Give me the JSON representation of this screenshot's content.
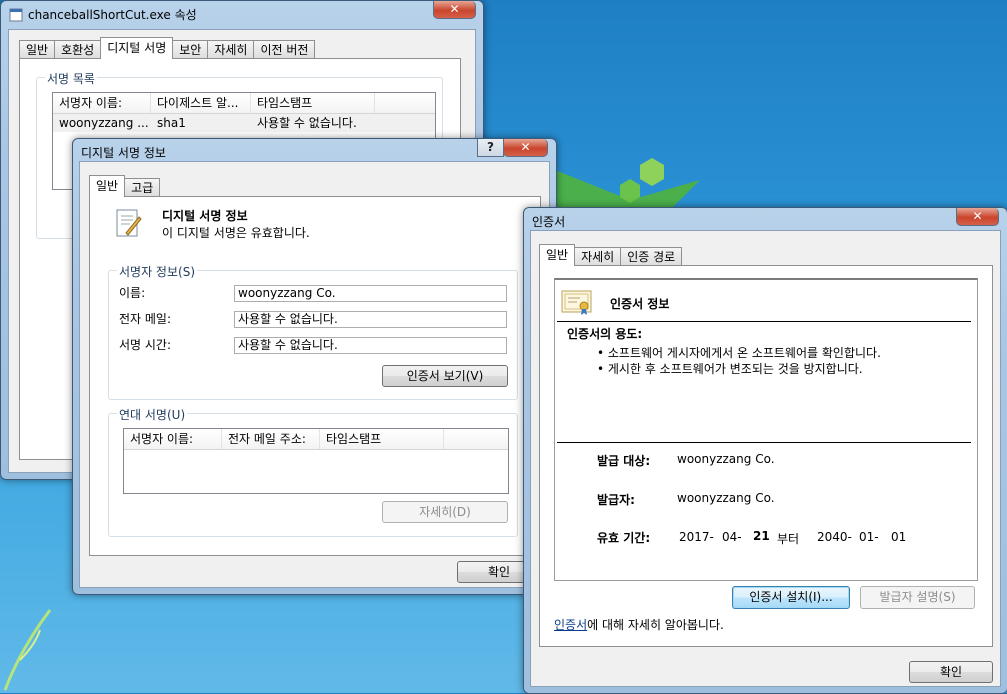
{
  "properties_window": {
    "title": "chanceballShortCut.exe 속성",
    "tabs": [
      "일반",
      "호환성",
      "디지털 서명",
      "보안",
      "자세히",
      "이전 버전"
    ],
    "signature_list_label": "서명 목록",
    "columns": [
      "서명자 이름:",
      "다이제스트 알...",
      "타임스탬프"
    ],
    "rows": [
      [
        "woonyzzang ...",
        "sha1",
        "사용할 수 없습니다."
      ]
    ]
  },
  "sig_info_window": {
    "title": "디지털 서명 정보",
    "help_button": "?",
    "tabs": [
      "일반",
      "고급"
    ],
    "heading": "디지털 서명 정보",
    "status": "이 디지털 서명은 유효합니다.",
    "signer_group": "서명자 정보(S)",
    "fields": [
      {
        "label": "이름:",
        "value": "woonyzzang Co."
      },
      {
        "label": "전자 메일:",
        "value": "사용할 수 없습니다."
      },
      {
        "label": "서명 시간:",
        "value": "사용할 수 없습니다."
      }
    ],
    "view_cert_button": "인증서 보기(V)",
    "countersig_group": "연대 서명(U)",
    "countersig_columns": [
      "서명자 이름:",
      "전자 메일 주소:",
      "타임스탬프"
    ],
    "details_button": "자세히(D)",
    "ok_button": "확인"
  },
  "cert_window": {
    "title": "인증서",
    "tabs": [
      "일반",
      "자세히",
      "인증 경로"
    ],
    "heading": "인증서 정보",
    "purpose_title": "인증서의 용도:",
    "purposes": [
      "• 소프트웨어 게시자에게서 온 소프트웨어를 확인합니다.",
      "• 게시한 후 소프트웨어가 변조되는 것을 방지합니다."
    ],
    "issued_to_label": "발급 대상:",
    "issued_to": "woonyzzang Co.",
    "issued_by_label": "발급자:",
    "issued_by": "woonyzzang Co.",
    "validity_label": "유효 기간:",
    "valid_from_y": "2017-",
    "valid_from_m": "04-",
    "valid_from_d": "21",
    "valid_sep": "부터",
    "valid_to_y": "2040-",
    "valid_to_m": "01-",
    "valid_to_d": "01",
    "install_button": "인증서 설치(I)...",
    "issuer_statement_button": "발급자 설명(S)",
    "learn_link": "인증서",
    "learn_text": "에 대해 자세히 알아봅니다.",
    "ok_button": "확인"
  }
}
